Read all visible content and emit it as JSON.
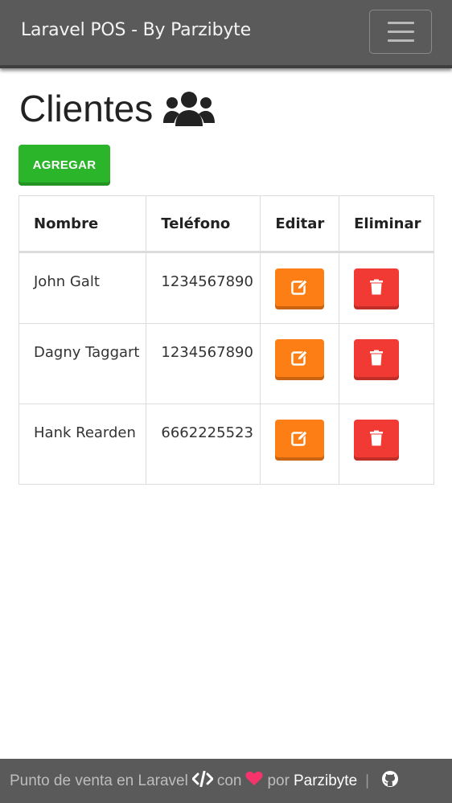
{
  "navbar": {
    "brand": "Laravel POS - By Parzibyte",
    "toggle_icon": "hamburger-menu-icon"
  },
  "page": {
    "title": "Clientes",
    "title_icon": "users-icon",
    "add_button": "AGREGAR"
  },
  "table": {
    "headers": [
      "Nombre",
      "Teléfono",
      "Editar",
      "Eliminar"
    ],
    "rows": [
      {
        "name": "John Galt",
        "phone": "1234567890"
      },
      {
        "name": "Dagny Taggart",
        "phone": "1234567890"
      },
      {
        "name": "Hank Rearden",
        "phone": "6662225523"
      }
    ],
    "edit_icon": "edit-icon",
    "delete_icon": "trash-icon"
  },
  "footer": {
    "prefix": "Punto de venta en Laravel",
    "con": "con",
    "por": "por",
    "author": "Parzibyte",
    "separator": "|"
  },
  "colors": {
    "navbar": "#5a5a5a",
    "add_button": "#2bb52b",
    "edit_button": "#fd7e14",
    "delete_button": "#f13a33",
    "heart": "#f6336b"
  }
}
